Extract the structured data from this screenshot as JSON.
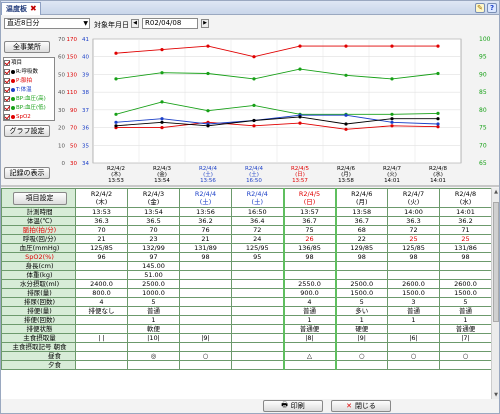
{
  "tab": {
    "title": "温度板",
    "close": "✖"
  },
  "toolbar": {
    "period_select": "直近8日分",
    "date_label": "対象年月日",
    "date_value": "R02/04/08",
    "prev": "◀",
    "next": "▶",
    "icon_note": "✎",
    "icon_help": "?"
  },
  "left": {
    "show_all_button": "全事業所",
    "graph_settings_button": "グラフ設定",
    "record_display_button": "記録の表示",
    "legend_header": "項目",
    "legend_items": [
      {
        "label": "R:呼吸数",
        "color": "#000000",
        "checked": true
      },
      {
        "label": "P:脈拍",
        "color": "#e00000",
        "checked": true
      },
      {
        "label": "T:体温",
        "color": "#1b3fc7",
        "checked": true
      },
      {
        "label": "BP:血圧(高)",
        "color": "#17a017",
        "checked": true
      },
      {
        "label": "BP:血圧(低)",
        "color": "#17a017",
        "checked": true
      },
      {
        "label": "SpO2",
        "color": "#e00000",
        "checked": true
      }
    ]
  },
  "chart_data": {
    "type": "line",
    "categories": [
      "R2/4/2 (木) 13:53",
      "R2/4/3 (金) 13:54",
      "R2/4/4 (土) 13:56",
      "R2/4/4 (土) 16:50",
      "R2/4/5 (日) 13:57",
      "R2/4/6 (月) 13:58",
      "R2/4/7 (火) 14:01",
      "R2/4/8 (水) 14:01"
    ],
    "x_tick_lines": [
      [
        "R2/4/2",
        "(木)",
        "13:53"
      ],
      [
        "R2/4/3",
        "(金)",
        "13:54"
      ],
      [
        "R2/4/4",
        "(土)",
        "13:56"
      ],
      [
        "R2/4/4",
        "(土)",
        "16:50"
      ],
      [
        "R2/4/5",
        "(日)",
        "13:57"
      ],
      [
        "R2/4/6",
        "(月)",
        "13:58"
      ],
      [
        "R2/4/7",
        "(火)",
        "14:01"
      ],
      [
        "R2/4/8",
        "(水)",
        "14:01"
      ]
    ],
    "x_tick_colors": [
      "#000000",
      "#000000",
      "#1b3fc7",
      "#1b3fc7",
      "#e00000",
      "#000000",
      "#000000",
      "#000000"
    ],
    "left_axis_cols": [
      {
        "color": "#555555",
        "ticks": [
          "70",
          "60",
          "50",
          "40",
          "30",
          "20",
          "10",
          "0"
        ]
      },
      {
        "color": "#e00000",
        "ticks": [
          "170",
          "150",
          "130",
          "110",
          "90",
          "70",
          "50",
          "30"
        ]
      },
      {
        "color": "#1b3fc7",
        "ticks": [
          "41",
          "40",
          "39",
          "38",
          "37",
          "36",
          "35",
          "34"
        ]
      }
    ],
    "right_axis": {
      "color": "#17a017",
      "ticks": [
        "100",
        "95",
        "90",
        "85",
        "80",
        "75",
        "70",
        "65"
      ]
    },
    "series": [
      {
        "name": "P",
        "axis": "pulse",
        "range": [
          30,
          170
        ],
        "color": "#e00000",
        "values": [
          70,
          70,
          76,
          72,
          75,
          68,
          72,
          71
        ]
      },
      {
        "name": "BP(高)",
        "axis": "pulse",
        "range": [
          30,
          170
        ],
        "color": "#17a017",
        "values": [
          125,
          132,
          131,
          125,
          136,
          129,
          125,
          131
        ]
      },
      {
        "name": "BP(低)",
        "axis": "pulse",
        "range": [
          30,
          170
        ],
        "color": "#17a017",
        "values": [
          85,
          99,
          89,
          95,
          85,
          85,
          85,
          86
        ]
      },
      {
        "name": "T",
        "axis": "temp",
        "range": [
          34,
          41
        ],
        "color": "#1b3fc7",
        "values": [
          36.3,
          36.5,
          36.2,
          36.4,
          36.7,
          36.7,
          36.3,
          36.2
        ]
      },
      {
        "name": "R",
        "axis": "resp",
        "range": [
          0,
          70
        ],
        "color": "#000000",
        "values": [
          21,
          23,
          21,
          24,
          26,
          22,
          25,
          25
        ]
      },
      {
        "name": "SpO2",
        "axis": "spo2",
        "range": [
          65,
          100
        ],
        "color": "#e00000",
        "values": [
          96,
          97,
          98,
          95,
          98,
          98,
          98,
          98
        ]
      }
    ]
  },
  "grid": {
    "header_label": "項目設定",
    "columns": [
      {
        "date": "R2/4/2",
        "dow": "(木)",
        "color": "#000000",
        "today": false
      },
      {
        "date": "R2/4/3",
        "dow": "(金)",
        "color": "#000000",
        "today": false
      },
      {
        "date": "R2/4/4",
        "dow": "(土)",
        "color": "#1b3fc7",
        "today": false
      },
      {
        "date": "R2/4/4",
        "dow": "(土)",
        "color": "#1b3fc7",
        "today": false
      },
      {
        "date": "R2/4/5",
        "dow": "(日)",
        "color": "#e00000",
        "today": true
      },
      {
        "date": "R2/4/6",
        "dow": "(月)",
        "color": "#000000",
        "today": false
      },
      {
        "date": "R2/4/7",
        "dow": "(火)",
        "color": "#000000",
        "today": false
      },
      {
        "date": "R2/4/8",
        "dow": "(水)",
        "color": "#000000",
        "today": false
      }
    ],
    "rows": [
      {
        "label": "計測時間",
        "lc": "",
        "align": "c",
        "cells": [
          "13:53",
          "13:54",
          "13:56",
          "16:50",
          "13:57",
          "13:58",
          "14:00",
          "14:01"
        ]
      },
      {
        "label": "体温(℃)",
        "lc": "",
        "align": "c",
        "cells": [
          "36.3",
          "36.5",
          "36.2",
          "36.4",
          "36.7",
          "36.7",
          "36.3",
          "36.2"
        ]
      },
      {
        "label": "脈拍(拍/分)",
        "lc": "red",
        "align": "c",
        "cells": [
          "70",
          "70",
          "76",
          "72",
          "75",
          "68",
          "72",
          "71"
        ]
      },
      {
        "label": "呼吸(回/分)",
        "lc": "",
        "align": "c",
        "cells": [
          "21",
          "23",
          "21",
          "24",
          "26",
          "22",
          "25",
          "25"
        ],
        "red": [
          4,
          6,
          7
        ]
      },
      {
        "label": "血圧(mmHg)",
        "lc": "",
        "align": "c",
        "cells": [
          "125/85",
          "132/99",
          "131/89",
          "125/95",
          "136/85",
          "129/85",
          "125/85",
          "131/86"
        ]
      },
      {
        "label": "SpO2(%)",
        "lc": "red",
        "align": "c",
        "cells": [
          "96",
          "97",
          "98",
          "95",
          "98",
          "98",
          "98",
          "98"
        ]
      },
      {
        "label": "身長(cm)",
        "lc": "",
        "align": "c",
        "cells": [
          "",
          "145.00",
          "",
          "",
          "",
          "",
          "",
          ""
        ]
      },
      {
        "label": "体重(kg)",
        "lc": "",
        "align": "c",
        "cells": [
          "",
          "51.00",
          "",
          "",
          "",
          "",
          "",
          ""
        ]
      },
      {
        "label": "水分摂取(ml)",
        "lc": "",
        "align": "c",
        "cells": [
          "2400.0",
          "2500.0",
          "",
          "",
          "2550.0",
          "2500.0",
          "2600.0",
          "2600.0"
        ]
      },
      {
        "label": "排尿(量)",
        "lc": "",
        "align": "c",
        "cells": [
          "800.0",
          "1000.0",
          "",
          "",
          "900.0",
          "1500.0",
          "1500.0",
          "1500.0"
        ]
      },
      {
        "label": "排尿(回数)",
        "lc": "",
        "align": "c",
        "cells": [
          "4",
          "5",
          "",
          "",
          "4",
          "5",
          "3",
          "5"
        ]
      },
      {
        "label": "排便(量)",
        "lc": "",
        "align": "c",
        "cells": [
          "排便なし",
          "普通",
          "",
          "",
          "普通",
          "多い",
          "普通",
          "普通"
        ]
      },
      {
        "label": "排便(回数)",
        "lc": "",
        "align": "c",
        "cells": [
          "",
          "1",
          "",
          "",
          "1",
          "1",
          "1",
          "1"
        ]
      },
      {
        "label": "排便状態",
        "lc": "",
        "align": "c",
        "cells": [
          "",
          "軟便",
          "",
          "",
          "普通便",
          "硬便",
          "",
          "普通便"
        ]
      },
      {
        "label": "主食摂取量",
        "lc": "",
        "align": "c",
        "cells": [
          "| |",
          "|10|",
          "|9|",
          "",
          "|8|",
          "|9|",
          "|6|",
          "|7|"
        ]
      },
      {
        "label": "主食摂取記号  朝食",
        "lc": "",
        "align": "c",
        "cells": [
          "",
          "",
          "",
          "",
          "",
          "",
          "",
          ""
        ]
      },
      {
        "label": "昼食",
        "lc": "",
        "align": "sub",
        "cells": [
          "",
          "◎",
          "○",
          "",
          "△",
          "○",
          "○",
          "○"
        ]
      },
      {
        "label": "夕食",
        "lc": "",
        "align": "sub",
        "cells": [
          "",
          "",
          "",
          "",
          "",
          "",
          "",
          ""
        ]
      }
    ]
  },
  "bottom": {
    "print_button": "印刷",
    "close_button": "閉じる",
    "print_icon": "🖶",
    "close_icon": "✕"
  }
}
